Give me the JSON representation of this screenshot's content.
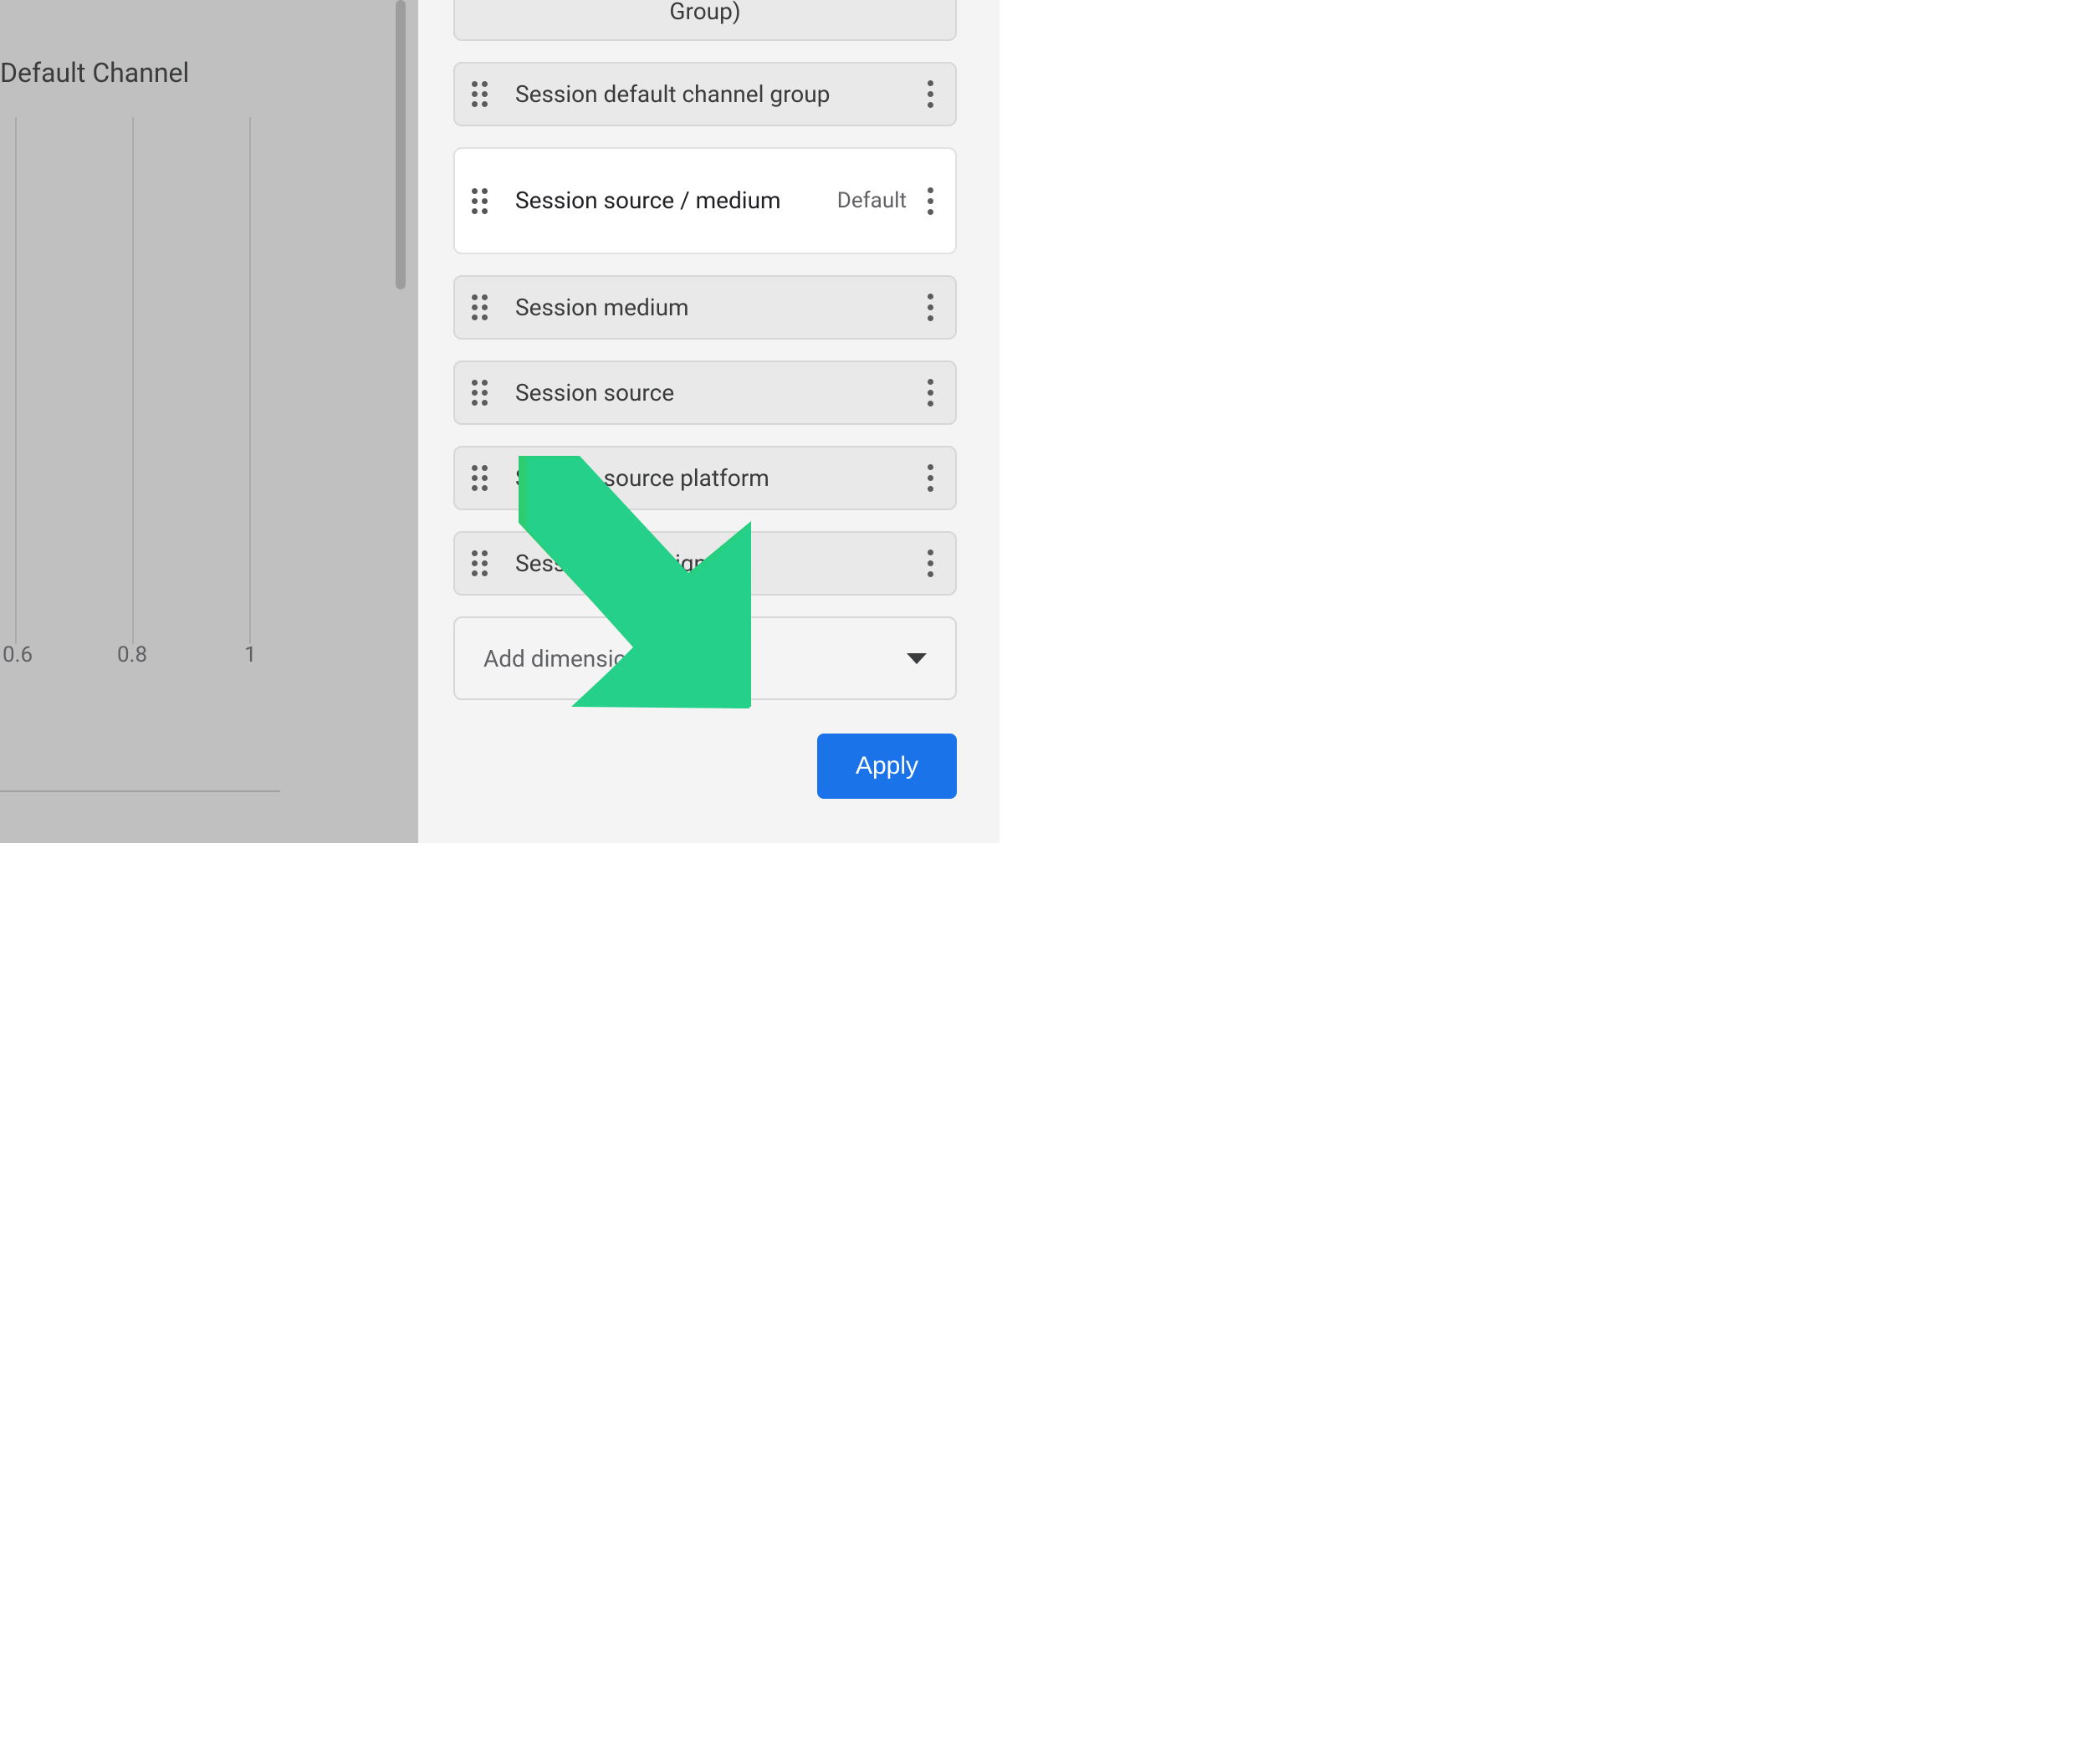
{
  "left": {
    "title": "Default Channel",
    "ticks": [
      "0.6",
      "0.8",
      "1"
    ]
  },
  "panel": {
    "items": [
      {
        "label": "Group)",
        "partial": true
      },
      {
        "label": "Session default channel group"
      },
      {
        "label": "Session source / medium",
        "selected": true,
        "tag": "Default"
      },
      {
        "label": "Session medium"
      },
      {
        "label": "Session source"
      },
      {
        "label": "Session source platform"
      },
      {
        "label": "Session campaign"
      }
    ],
    "add_label": "Add dimension",
    "apply_label": "Apply"
  }
}
